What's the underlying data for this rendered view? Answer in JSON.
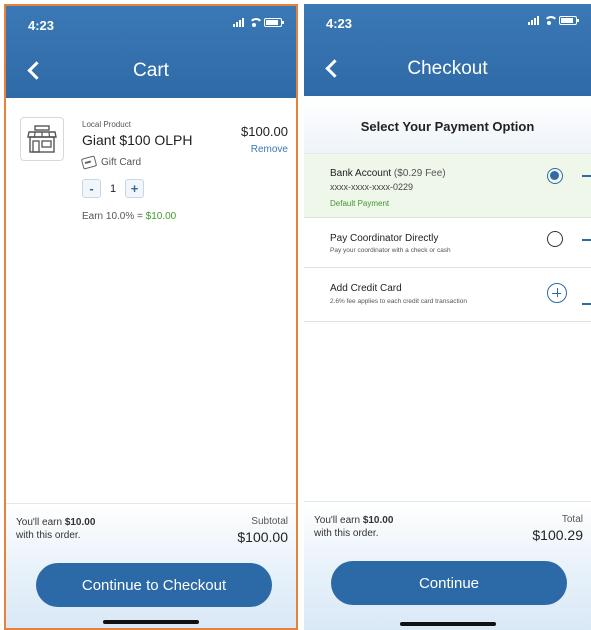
{
  "cart_screen": {
    "status_time": "4:23",
    "title": "Cart",
    "item": {
      "label": "Local Product",
      "name": "Giant $100 OLPH",
      "price": "$100.00",
      "remove_label": "Remove",
      "type_label": "Gift Card",
      "minus_label": "-",
      "quantity": "1",
      "plus_label": "+",
      "earn_prefix": "Earn 10.0% = ",
      "earn_amount": "$10.00"
    },
    "footer": {
      "earn_prefix": "You'll earn ",
      "earn_amount": "$10.00",
      "earn_suffix": "with this order.",
      "total_label": "Subtotal",
      "total_value": "$100.00",
      "button_label": "Continue to Checkout"
    }
  },
  "checkout_screen": {
    "status_time": "4:23",
    "title": "Checkout",
    "section_title": "Select Your Payment Option",
    "options": [
      {
        "title": "Bank Account",
        "fee": " ($0.29 Fee)",
        "account": "xxxx-xxxx-xxxx-0229",
        "note": "Default Payment",
        "selected": true
      },
      {
        "title": "Pay Coordinator Directly",
        "subtitle": "Pay your coordinator with a check or cash",
        "selected": false
      },
      {
        "title": "Add Credit Card",
        "subtitle": "2.6% fee applies to each credit card transaction"
      }
    ],
    "footer": {
      "earn_prefix": "You'll earn ",
      "earn_amount": "$10.00",
      "earn_suffix": "with this order.",
      "total_label": "Total",
      "total_value": "$100.29",
      "button_label": "Continue"
    }
  },
  "colors": {
    "header_blue": "#2f6aa6",
    "accent_green": "#3f9a2e",
    "focus_outline": "#e8823a"
  }
}
